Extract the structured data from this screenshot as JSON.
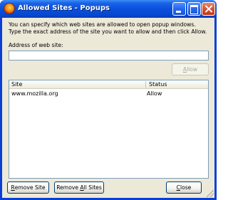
{
  "window": {
    "title": "Allowed Sites - Popups"
  },
  "content": {
    "description": "You can specify which web sites are allowed to open popup windows. Type the exact address of the site you want to allow and then click Allow.",
    "address_label": "Address of web site:",
    "address_value": "",
    "allow_button": {
      "accesskey": "A",
      "rest": "llow",
      "enabled": false
    }
  },
  "list": {
    "columns": [
      "Site",
      "Status"
    ],
    "rows": [
      {
        "site": "www.mozilla.org",
        "status": "Allow"
      }
    ]
  },
  "buttons": {
    "remove_site": {
      "accesskey": "R",
      "rest": "emove Site"
    },
    "remove_all": {
      "pre": "Remove ",
      "accesskey": "A",
      "rest": "ll Sites"
    },
    "close": {
      "accesskey": "C",
      "rest": "lose"
    }
  },
  "colors": {
    "titlebar": "#0a50dc",
    "dialog_bg": "#ece9d8",
    "border": "#7f9db9"
  }
}
